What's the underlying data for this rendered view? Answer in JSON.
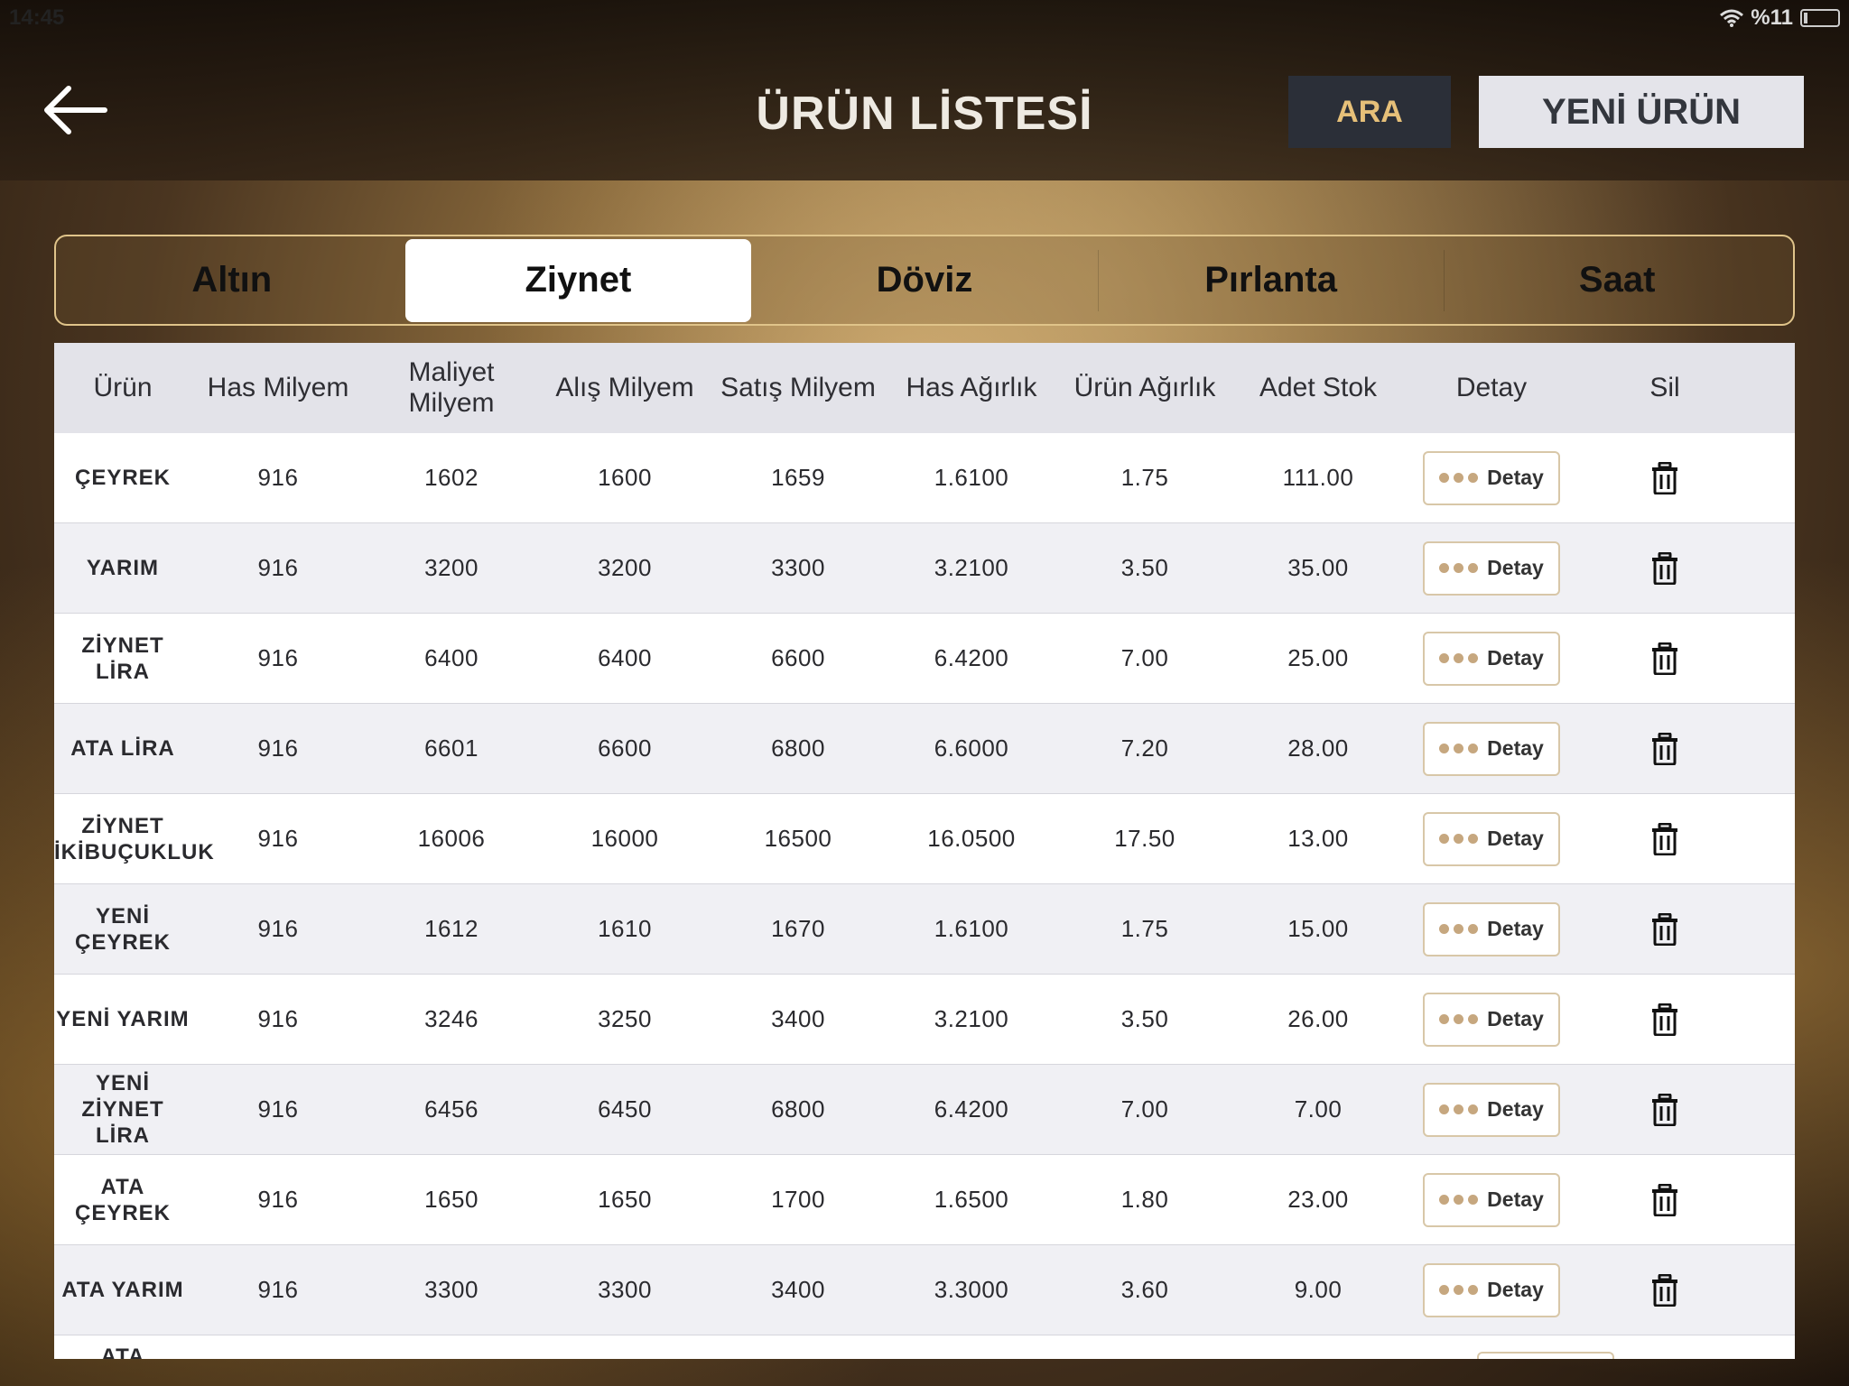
{
  "status_bar": {
    "time": "14:45",
    "battery": "%11"
  },
  "header": {
    "title": "ÜRÜN LİSTESİ",
    "search_label": "ARA",
    "new_label": "YENİ ÜRÜN"
  },
  "tabs": [
    {
      "label": "Altın",
      "active": false
    },
    {
      "label": "Ziynet",
      "active": true
    },
    {
      "label": "Döviz",
      "active": false
    },
    {
      "label": "Pırlanta",
      "active": false
    },
    {
      "label": "Saat",
      "active": false
    }
  ],
  "table": {
    "columns": [
      "Ürün",
      "Has Milyem",
      "Maliyet Milyem",
      "Alış Milyem",
      "Satış Milyem",
      "Has Ağırlık",
      "Ürün Ağırlık",
      "Adet Stok",
      "Detay",
      "Sil"
    ],
    "detail_label": "Detay",
    "rows": [
      {
        "name": "ÇEYREK",
        "has_milyem": "916",
        "maliyet": "1602",
        "alis": "1600",
        "satis": "1659",
        "has_agirlik": "1.6100",
        "urun_agirlik": "1.75",
        "stok": "111.00"
      },
      {
        "name": "YARIM",
        "has_milyem": "916",
        "maliyet": "3200",
        "alis": "3200",
        "satis": "3300",
        "has_agirlik": "3.2100",
        "urun_agirlik": "3.50",
        "stok": "35.00"
      },
      {
        "name": "ZİYNET LİRA",
        "has_milyem": "916",
        "maliyet": "6400",
        "alis": "6400",
        "satis": "6600",
        "has_agirlik": "6.4200",
        "urun_agirlik": "7.00",
        "stok": "25.00"
      },
      {
        "name": "ATA LİRA",
        "has_milyem": "916",
        "maliyet": "6601",
        "alis": "6600",
        "satis": "6800",
        "has_agirlik": "6.6000",
        "urun_agirlik": "7.20",
        "stok": "28.00"
      },
      {
        "name": "ZİYNET İKİBUÇUKLUK",
        "has_milyem": "916",
        "maliyet": "16006",
        "alis": "16000",
        "satis": "16500",
        "has_agirlik": "16.0500",
        "urun_agirlik": "17.50",
        "stok": "13.00"
      },
      {
        "name": "YENİ ÇEYREK",
        "has_milyem": "916",
        "maliyet": "1612",
        "alis": "1610",
        "satis": "1670",
        "has_agirlik": "1.6100",
        "urun_agirlik": "1.75",
        "stok": "15.00"
      },
      {
        "name": "YENİ YARIM",
        "has_milyem": "916",
        "maliyet": "3246",
        "alis": "3250",
        "satis": "3400",
        "has_agirlik": "3.2100",
        "urun_agirlik": "3.50",
        "stok": "26.00"
      },
      {
        "name": "YENİ ZİYNET LİRA",
        "has_milyem": "916",
        "maliyet": "6456",
        "alis": "6450",
        "satis": "6800",
        "has_agirlik": "6.4200",
        "urun_agirlik": "7.00",
        "stok": "7.00"
      },
      {
        "name": "ATA ÇEYREK",
        "has_milyem": "916",
        "maliyet": "1650",
        "alis": "1650",
        "satis": "1700",
        "has_agirlik": "1.6500",
        "urun_agirlik": "1.80",
        "stok": "23.00"
      },
      {
        "name": "ATA YARIM",
        "has_milyem": "916",
        "maliyet": "3300",
        "alis": "3300",
        "satis": "3400",
        "has_agirlik": "3.3000",
        "urun_agirlik": "3.60",
        "stok": "9.00"
      }
    ],
    "partial_row_name": "ATA"
  }
}
